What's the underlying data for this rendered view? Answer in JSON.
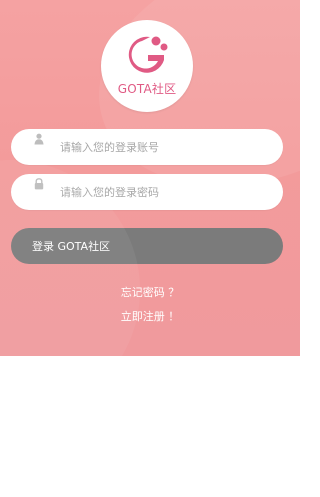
{
  "logo": {
    "icon": "gota-logo-icon",
    "text": "GOTA社区",
    "color": "#e05a84"
  },
  "form": {
    "username": {
      "icon": "user-icon",
      "placeholder": "请输入您的登录账号",
      "value": ""
    },
    "password": {
      "icon": "lock-icon",
      "placeholder": "请输入您的登录密码",
      "value": ""
    },
    "login_label": "登录 GOTA社区"
  },
  "links": {
    "forgot": "忘记密码 ？",
    "register": "立即注册 ！"
  },
  "colors": {
    "background": "#f39b9b",
    "button": "#7b7b7b",
    "brand": "#e05a84"
  }
}
